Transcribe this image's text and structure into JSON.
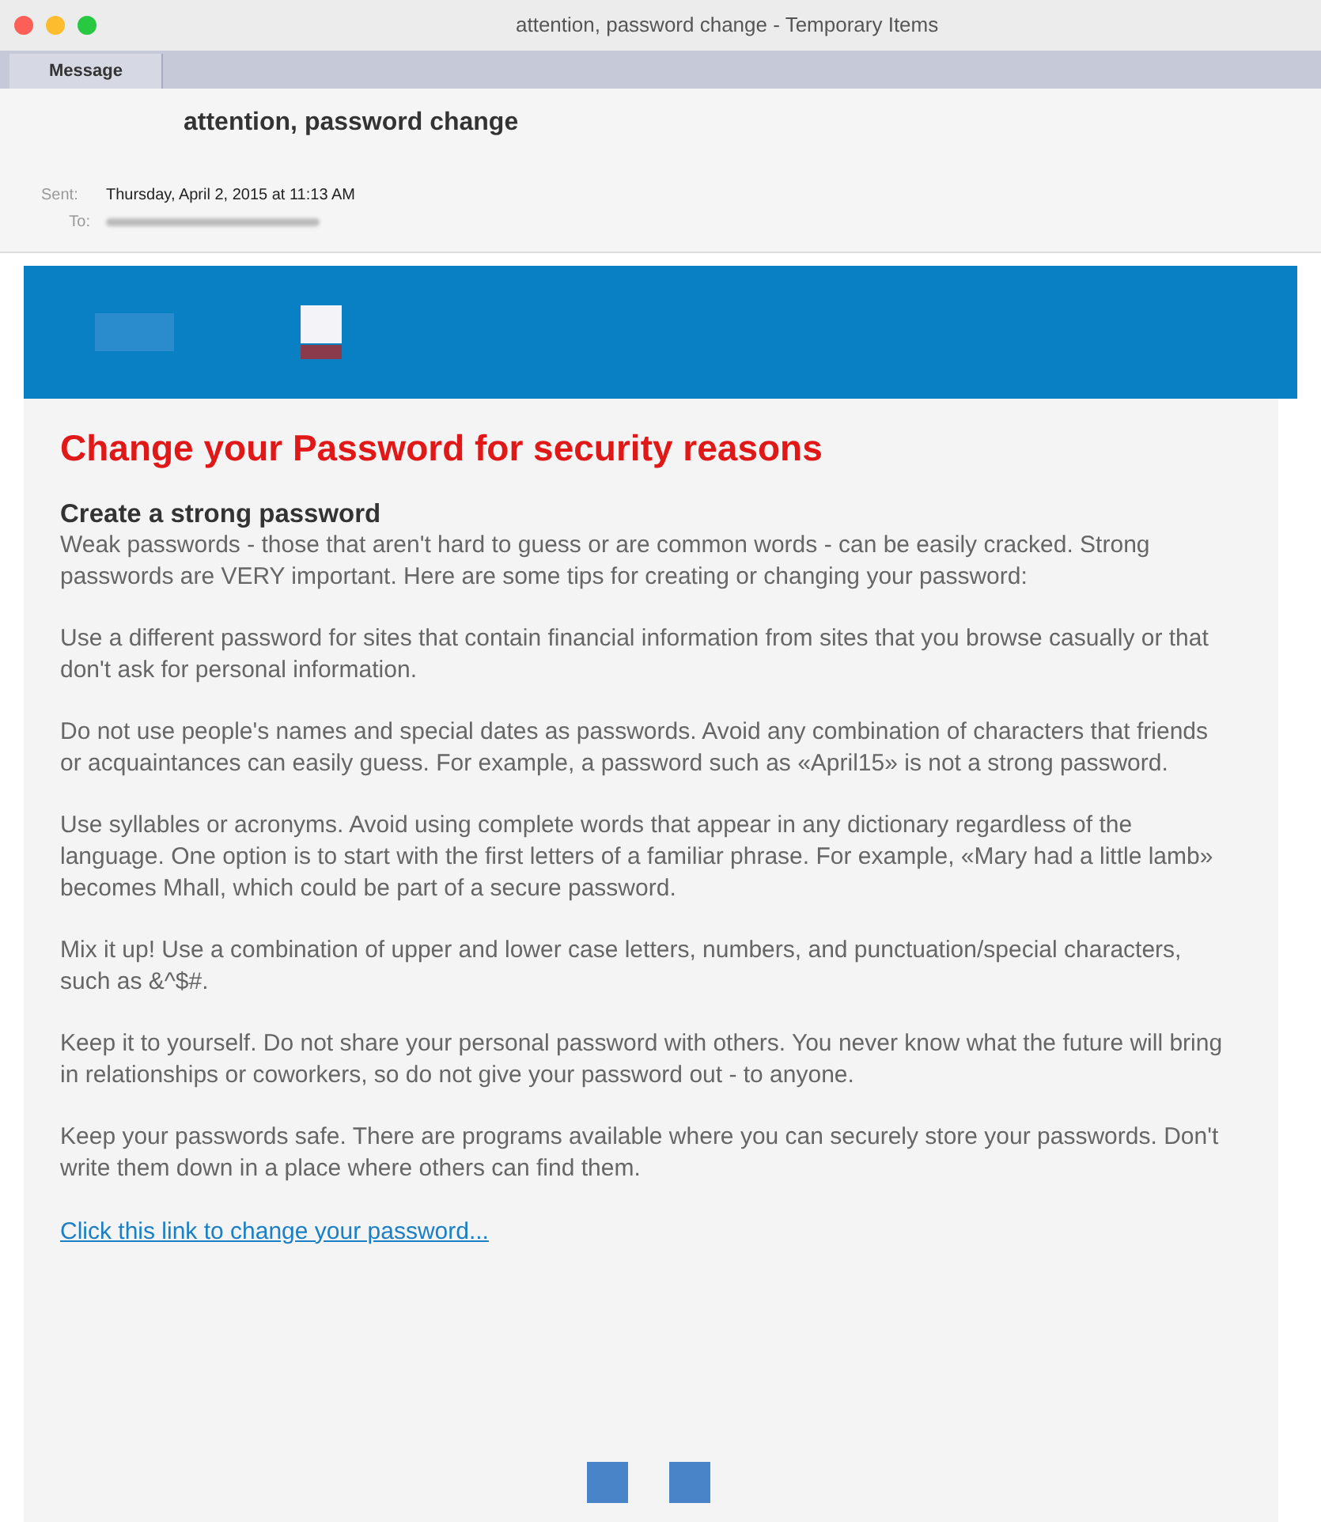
{
  "window": {
    "title": "attention, password change - Temporary Items"
  },
  "toolbar": {
    "tabs": [
      {
        "label": "Message",
        "selected": true
      }
    ]
  },
  "header": {
    "subject": "attention, password change",
    "sent_label": "Sent:",
    "sent_value": "Thursday, April 2, 2015 at 11:13 AM",
    "to_label": "To:"
  },
  "email": {
    "heading": "Change your Password for security reasons",
    "subheading": "Create a strong password",
    "paragraphs": [
      "Weak passwords - those that aren't hard to guess or are common words - can be easily cracked. Strong passwords are VERY important. Here are some tips for creating or changing your password:",
      "Use a different password for sites that contain financial information from sites that you browse casually or that don't ask for personal information.",
      "Do not use people's names and special dates as passwords. Avoid any combination of characters that friends or acquaintances can easily guess. For example, a password such as «April15» is not a strong password.",
      "Use syllables or acronyms. Avoid using complete words that appear in any dictionary regardless of the language. One option is to start with the first letters of a familiar phrase. For example, «Mary had a little lamb» becomes Mhall, which could be part of a secure password.",
      "Mix it up! Use a combination of upper and lower case letters, numbers, and punctuation/special characters, such as &^$#.",
      "Keep it to yourself. Do not share your personal password with others. You never know what the future will bring in relationships or coworkers, so do not give your password out - to anyone.",
      "Keep your passwords safe. There are programs available where you can securely store your passwords. Don't write them down in a place where others can find them."
    ],
    "link": "Click this link to change your password..."
  }
}
